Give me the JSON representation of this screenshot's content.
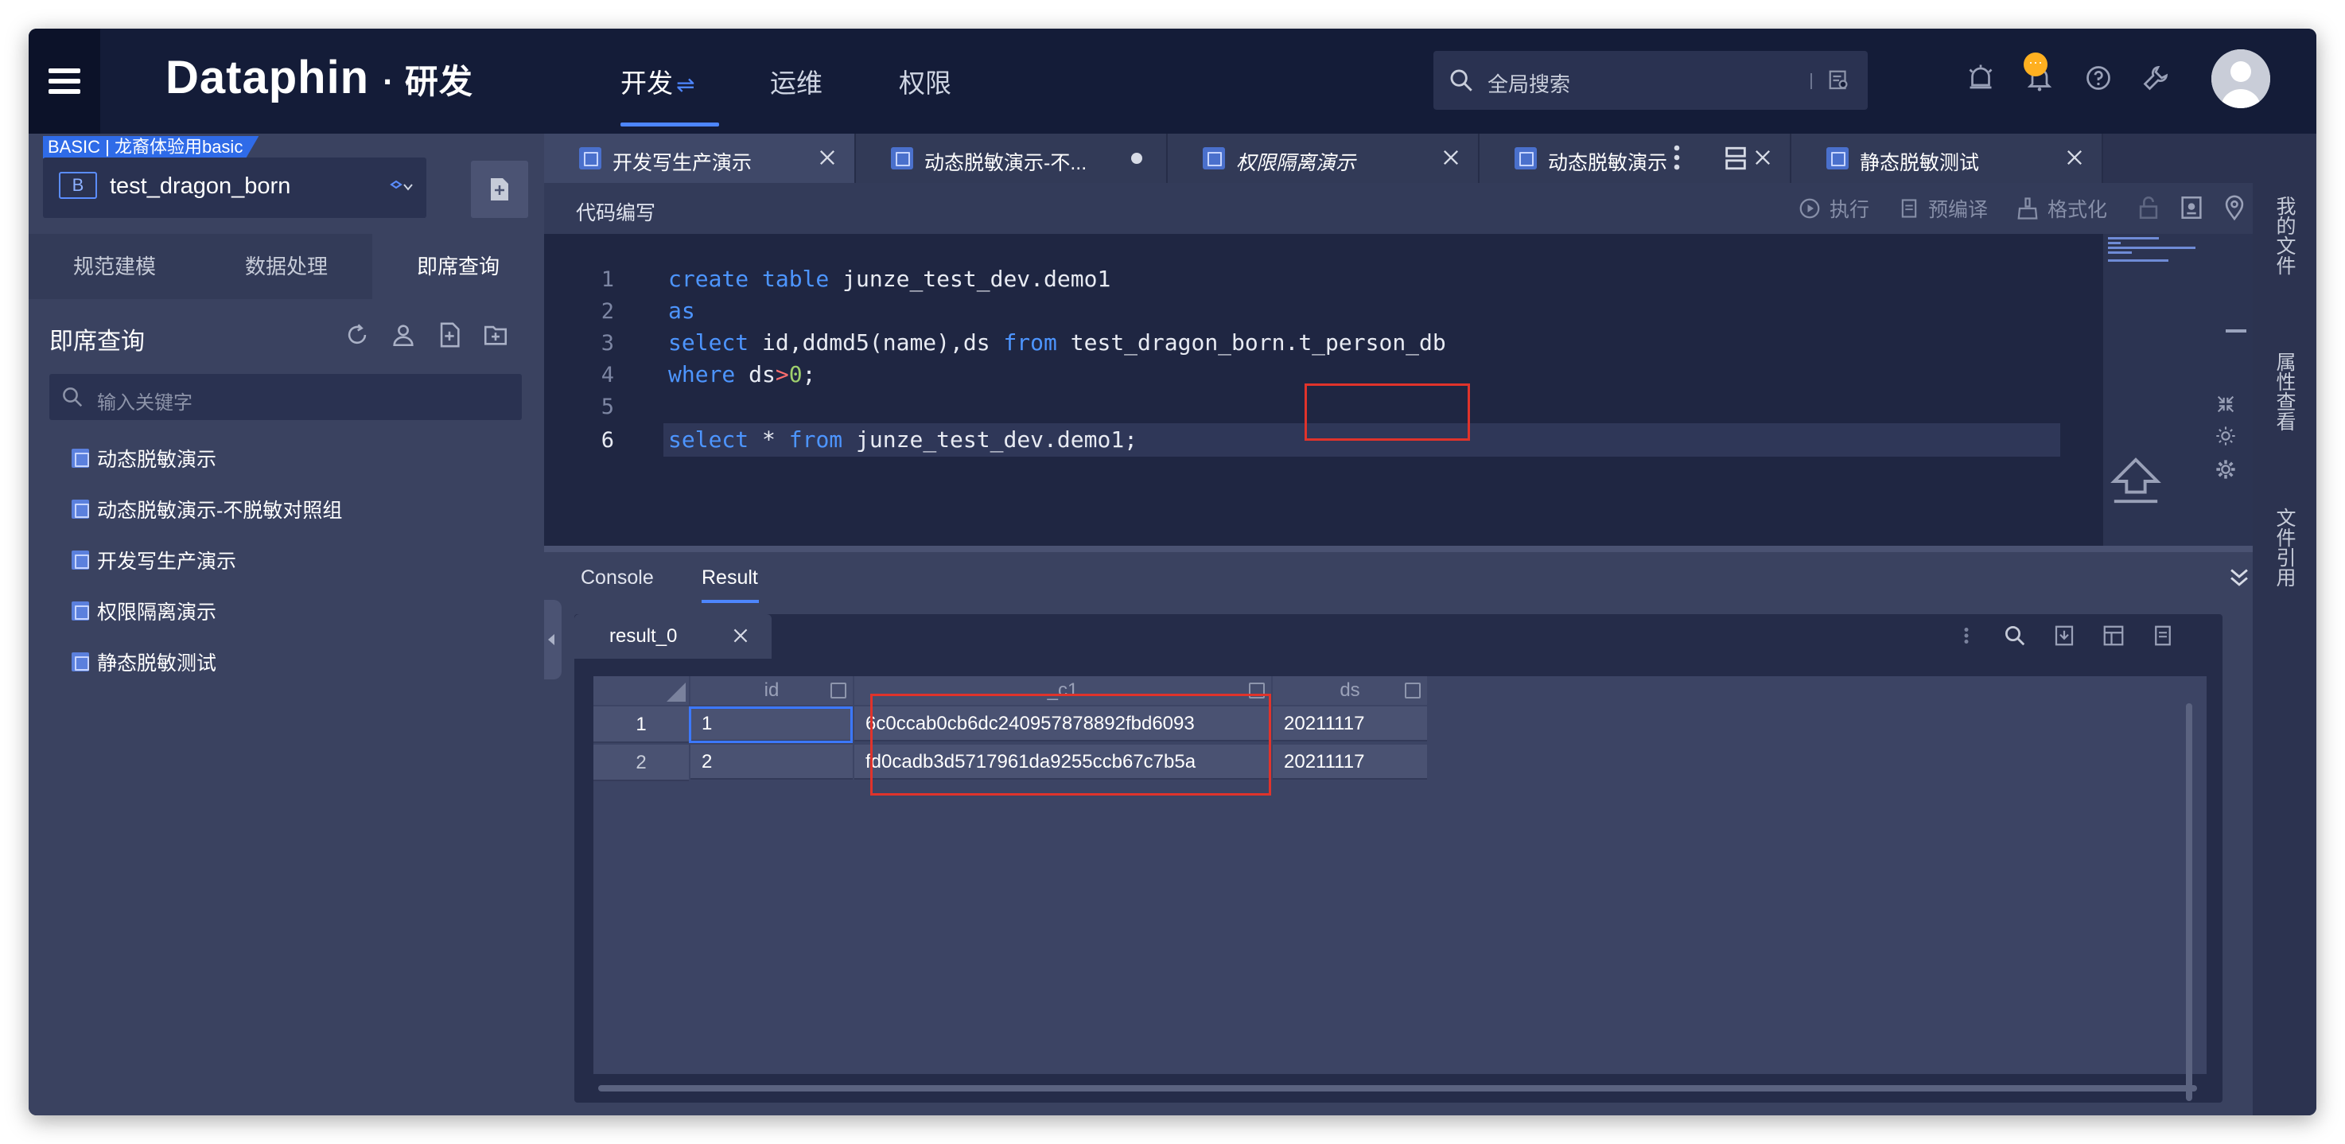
{
  "header": {
    "brand": "Dataphin",
    "brand_sub": "· 研发",
    "nav": [
      "开发",
      "运维",
      "权限"
    ],
    "nav_swap": "⇌",
    "search_placeholder": "全局搜索",
    "notification_badge": "···",
    "accent_color": "#4d86ff"
  },
  "sidebar": {
    "badge": "BASIC | 龙裔体验用basic",
    "project_letter": "B",
    "project_name": "test_dragon_born",
    "tabs": [
      "规范建模",
      "数据处理",
      "即席查询"
    ],
    "active_tab": "即席查询",
    "panel_title": "即席查询",
    "search_placeholder": "输入关键字",
    "items": [
      "动态脱敏演示",
      "动态脱敏演示-不脱敏对照组",
      "开发写生产演示",
      "权限隔离演示",
      "静态脱敏测试"
    ]
  },
  "editor": {
    "tabs": [
      {
        "label": "开发写生产演示",
        "active": true
      },
      {
        "label": "动态脱敏演示-不...",
        "modified": true
      },
      {
        "label": "权限隔离演示",
        "italic": true
      },
      {
        "label": "动态脱敏演示"
      },
      {
        "label": "静态脱敏测试"
      }
    ],
    "toolbar_title": "代码编写",
    "toolbar": {
      "run": "执行",
      "precompile": "预编译",
      "format": "格式化"
    },
    "line_numbers": [
      "1",
      "2",
      "3",
      "4",
      "5",
      "6"
    ],
    "code": {
      "l1_kw": "create table",
      "l1_rest": " junze_test_dev.demo1",
      "l2_kw": "as",
      "l3_kw": "select",
      "l3_a": " id,ddmd5(name),ds ",
      "l3_kw2": "from",
      "l3_b": " test_dragon_born.t_person_db",
      "l4_kw": "where",
      "l4_a": " ds",
      "l4_op": ">",
      "l4_num": "0",
      "l4_end": ";",
      "l6_kw": "select",
      "l6_a": " * ",
      "l6_kw2": "from",
      "l6_b": " junze_test_dev.demo1;"
    }
  },
  "right_rail": [
    "我的文件",
    "属性查看",
    "文件引用"
  ],
  "result": {
    "tabs": [
      "Console",
      "Result"
    ],
    "active_tab": "Result",
    "result_tab_label": "result_0",
    "columns": [
      "id",
      "_c1",
      "ds"
    ],
    "rows": [
      {
        "n": "1",
        "id": "1",
        "c1": "6c0ccab0cb6dc240957878892fbd6093",
        "ds": "20211117"
      },
      {
        "n": "2",
        "id": "2",
        "c1": "fd0cadb3d5717961da9255ccb67c7b5a",
        "ds": "20211117"
      }
    ]
  },
  "highlight_color": "#e0332b"
}
